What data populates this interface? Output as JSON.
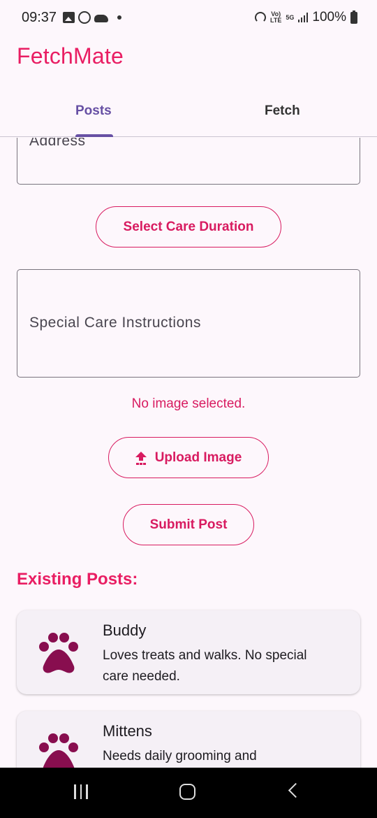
{
  "status_bar": {
    "time": "09:37",
    "battery": "100%",
    "network_tag_top": "Vo)",
    "network_tag_bottom": "LTE",
    "network_gen": "5G",
    "left_icons": [
      "gallery-icon",
      "whatsapp-icon",
      "cloud-icon",
      "dot-icon"
    ],
    "right_icons": [
      "hotspot-icon",
      "volte-icon",
      "5g-icon",
      "signal-icon",
      "battery-icon"
    ]
  },
  "app": {
    "title": "FetchMate",
    "accent_color": "#e91e63",
    "tab_color": "#6750a4"
  },
  "tabs": [
    {
      "label": "Posts",
      "selected": true
    },
    {
      "label": "Fetch",
      "selected": false
    }
  ],
  "form": {
    "address_label": "Address",
    "duration_button": "Select Care Duration",
    "instructions_label": "Special Care Instructions",
    "image_status": "No image selected.",
    "upload_button": "Upload Image",
    "upload_icon": "upload-icon",
    "submit_button": "Submit Post"
  },
  "posts": {
    "heading": "Existing Posts:",
    "items": [
      {
        "name": "Buddy",
        "description": "Loves treats and walks. No special care needed.",
        "icon": "paw-icon"
      },
      {
        "name": "Mittens",
        "description": "Needs daily grooming and",
        "icon": "paw-icon"
      }
    ]
  },
  "nav": {
    "icons": [
      "recents-icon",
      "home-icon",
      "back-icon"
    ]
  }
}
